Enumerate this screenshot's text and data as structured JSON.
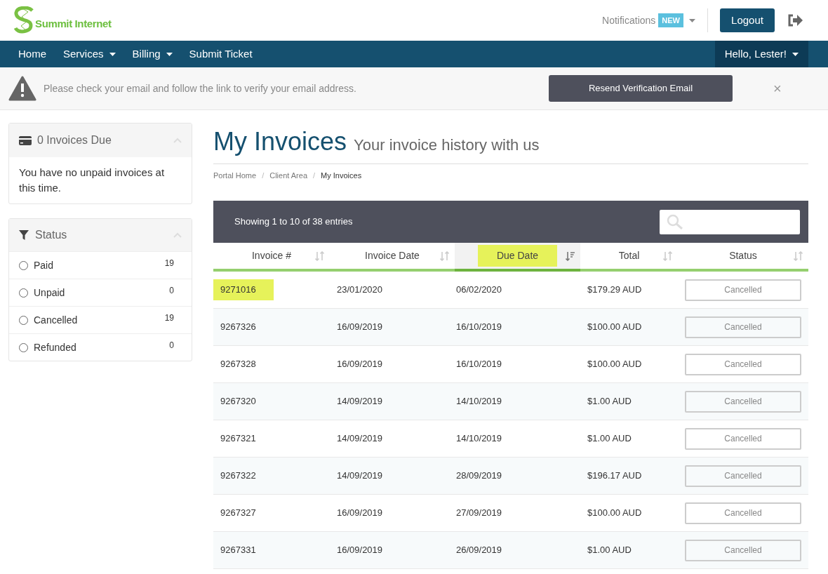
{
  "logo": {
    "text": "Summit Internet"
  },
  "top_bar": {
    "notifications": "Notifications",
    "badge": "NEW",
    "logout": "Logout"
  },
  "nav": {
    "items": [
      {
        "label": "Home",
        "dropdown": false
      },
      {
        "label": "Services",
        "dropdown": true
      },
      {
        "label": "Billing",
        "dropdown": true
      },
      {
        "label": "Submit Ticket",
        "dropdown": false
      }
    ],
    "user": "Hello, Lester!"
  },
  "alert": {
    "message": "Please check your email and follow the link to verify your email address.",
    "button": "Resend Verification Email",
    "close": "×"
  },
  "sidebar": {
    "due_panel": {
      "title": "0 Invoices Due",
      "body": "You have no unpaid invoices at this time."
    },
    "status_panel": {
      "title": "Status",
      "items": [
        {
          "label": "Paid",
          "count": "19",
          "selected": false
        },
        {
          "label": "Unpaid",
          "count": "0",
          "selected": false
        },
        {
          "label": "Cancelled",
          "count": "19",
          "selected": false
        },
        {
          "label": "Refunded",
          "count": "0",
          "selected": false
        }
      ]
    }
  },
  "page": {
    "title": "My Invoices",
    "subtitle": "Your invoice history with us",
    "breadcrumb_separator": "/",
    "breadcrumb": [
      {
        "label": "Portal Home",
        "current": false
      },
      {
        "label": "Client Area",
        "current": false
      },
      {
        "label": "My Invoices",
        "current": true
      }
    ]
  },
  "table": {
    "info": "Showing 1 to 10 of 38 entries",
    "columns": [
      {
        "label": "Invoice #",
        "sorted": false,
        "highlighted": false
      },
      {
        "label": "Invoice Date",
        "sorted": false,
        "highlighted": false
      },
      {
        "label": "Due Date",
        "sorted": true,
        "highlighted": true
      },
      {
        "label": "Total",
        "sorted": false,
        "highlighted": false
      },
      {
        "label": "Status",
        "sorted": false,
        "highlighted": false
      }
    ],
    "rows": [
      {
        "invoice": "9271016",
        "highlighted": true,
        "invoice_date": "23/01/2020",
        "due_date": "06/02/2020",
        "total": "$179.29 AUD",
        "status": "Cancelled"
      },
      {
        "invoice": "9267326",
        "highlighted": false,
        "invoice_date": "16/09/2019",
        "due_date": "16/10/2019",
        "total": "$100.00 AUD",
        "status": "Cancelled"
      },
      {
        "invoice": "9267328",
        "highlighted": false,
        "invoice_date": "16/09/2019",
        "due_date": "16/10/2019",
        "total": "$100.00 AUD",
        "status": "Cancelled"
      },
      {
        "invoice": "9267320",
        "highlighted": false,
        "invoice_date": "14/09/2019",
        "due_date": "14/10/2019",
        "total": "$1.00 AUD",
        "status": "Cancelled"
      },
      {
        "invoice": "9267321",
        "highlighted": false,
        "invoice_date": "14/09/2019",
        "due_date": "14/10/2019",
        "total": "$1.00 AUD",
        "status": "Cancelled"
      },
      {
        "invoice": "9267322",
        "highlighted": false,
        "invoice_date": "14/09/2019",
        "due_date": "28/09/2019",
        "total": "$196.17 AUD",
        "status": "Cancelled"
      },
      {
        "invoice": "9267327",
        "highlighted": false,
        "invoice_date": "16/09/2019",
        "due_date": "27/09/2019",
        "total": "$100.00 AUD",
        "status": "Cancelled"
      },
      {
        "invoice": "9267331",
        "highlighted": false,
        "invoice_date": "16/09/2019",
        "due_date": "26/09/2019",
        "total": "$1.00 AUD",
        "status": "Cancelled"
      }
    ]
  }
}
